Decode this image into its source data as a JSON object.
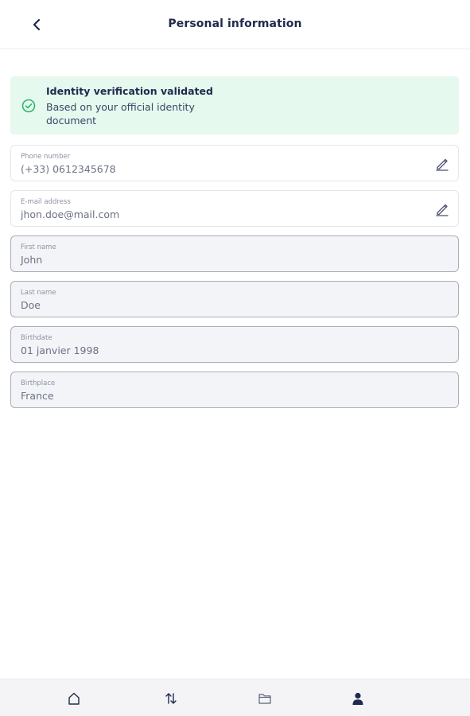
{
  "header": {
    "title": "Personal information",
    "back_icon": "chevron-left-icon"
  },
  "verification": {
    "title": "Identity verification validated",
    "description": "Based on your official identity document",
    "icon": "check-circle-icon",
    "color": "#2fb56b",
    "background": "#e6f9ee"
  },
  "fields": {
    "phone": {
      "label": "Phone number",
      "value": "(+33) 0612345678",
      "editable": true
    },
    "email": {
      "label": "E-mail address",
      "value": "jhon.doe@mail.com",
      "editable": true
    },
    "first_name": {
      "label": "First name",
      "value": "John",
      "editable": false
    },
    "last_name": {
      "label": "Last name",
      "value": "Doe",
      "editable": false
    },
    "birthdate": {
      "label": "Birthdate",
      "value": "01 janvier 1998",
      "editable": false
    },
    "birthplace": {
      "label": "Birthplace",
      "value": "France",
      "editable": false
    }
  },
  "bottom_nav": {
    "items": [
      {
        "icon": "home-icon",
        "active": false
      },
      {
        "icon": "transfer-arrows-icon",
        "active": false
      },
      {
        "icon": "folder-icon",
        "active": false
      },
      {
        "icon": "profile-icon",
        "active": true
      }
    ]
  }
}
